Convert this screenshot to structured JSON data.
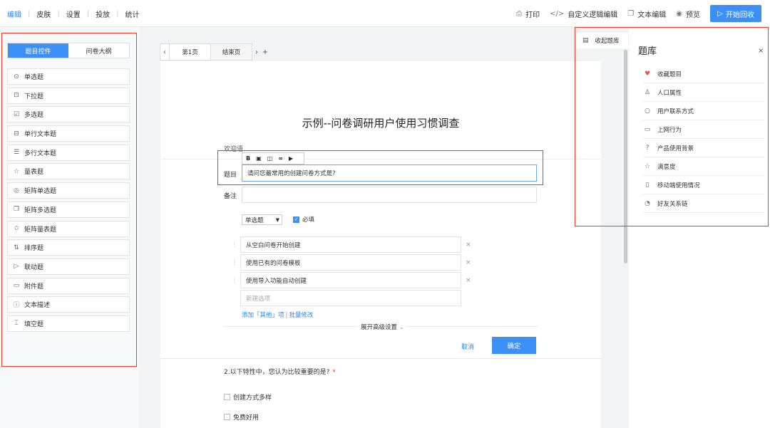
{
  "topbar": {
    "nav": [
      "编辑",
      "皮肤",
      "设置",
      "投放",
      "统计"
    ],
    "tools": [
      {
        "label": "打印",
        "icon": "print-icon"
      },
      {
        "label": "自定义逻辑编辑",
        "icon": "code-icon"
      },
      {
        "label": "文本编辑",
        "icon": "text-edit-icon"
      },
      {
        "label": "预览",
        "icon": "eye-icon"
      }
    ],
    "start_label": "开始回收"
  },
  "left": {
    "tabs": [
      "题目控件",
      "问卷大纲"
    ],
    "controls": [
      {
        "label": "单选题",
        "icon": "radio-icon"
      },
      {
        "label": "下拉题",
        "icon": "dropdown-icon"
      },
      {
        "label": "多选题",
        "icon": "checkbox-icon"
      },
      {
        "label": "单行文本题",
        "icon": "single-line-icon"
      },
      {
        "label": "多行文本题",
        "icon": "multi-line-icon"
      },
      {
        "label": "量表题",
        "icon": "star-icon"
      },
      {
        "label": "矩阵单选题",
        "icon": "matrix-radio-icon"
      },
      {
        "label": "矩阵多选题",
        "icon": "matrix-checkbox-icon"
      },
      {
        "label": "矩阵量表题",
        "icon": "matrix-scale-icon"
      },
      {
        "label": "排序题",
        "icon": "sort-icon"
      },
      {
        "label": "联动题",
        "icon": "linkage-icon"
      },
      {
        "label": "附件题",
        "icon": "attachment-icon"
      },
      {
        "label": "文本描述",
        "icon": "info-icon"
      },
      {
        "label": "填空题",
        "icon": "fill-blank-icon"
      }
    ]
  },
  "pages": {
    "tabs": [
      "第1页",
      "结束页"
    ]
  },
  "survey": {
    "title": "示例--问卷调研用户使用习惯调查",
    "welcome": "欢迎语",
    "q_label": "题目",
    "note_label": "备注",
    "question": "请问您最常用的创建问卷方式是?",
    "type": "单选题",
    "required": "必填",
    "options": [
      "从空白问卷开始创建",
      "使用已有的问卷模板",
      "使用导入功能自动创建"
    ],
    "new_option": "新建选项",
    "add_other": "添加「其他」项",
    "batch_edit": "批量修改",
    "advanced": "展开高级设置",
    "cancel": "取消",
    "confirm": "确定",
    "q2": "2.以下特性中，您认为比较重要的是?",
    "q2_star": "*",
    "q2_options": [
      "创建方式多样",
      "免费好用"
    ]
  },
  "library": {
    "toggle_label": "收起题库",
    "title": "题库",
    "items": [
      {
        "label": "收藏题目",
        "icon": "heart-icon"
      },
      {
        "label": "人口属性",
        "icon": "person-icon"
      },
      {
        "label": "用户联系方式",
        "icon": "chat-icon"
      },
      {
        "label": "上网行为",
        "icon": "window-icon"
      },
      {
        "label": "产品使用背景",
        "icon": "question-icon"
      },
      {
        "label": "满意度",
        "icon": "star-icon"
      },
      {
        "label": "移动端使用情况",
        "icon": "mobile-icon"
      },
      {
        "label": "好友关系链",
        "icon": "relation-icon"
      }
    ]
  }
}
